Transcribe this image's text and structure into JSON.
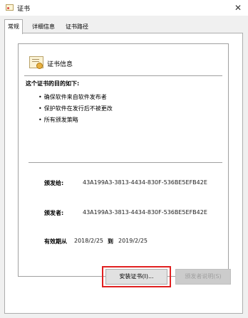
{
  "window": {
    "title": "证书",
    "close_glyph": "✕",
    "icon": "certificate-icon"
  },
  "tabs": [
    {
      "label": "常规",
      "active": true
    },
    {
      "label": "详细信息",
      "active": false
    },
    {
      "label": "证书路径",
      "active": false
    }
  ],
  "cert_info": {
    "title": "证书信息",
    "purpose_heading": "这个证书的目的如下:",
    "purposes": [
      "确保软件来自软件发布者",
      "保护软件在发行后不被更改",
      "所有颁发策略"
    ],
    "issued_to_label": "颁发给:",
    "issued_to_value": "43A199A3-3813-4434-830F-536BE5EFB42E",
    "issued_by_label": "颁发者:",
    "issued_by_value": "43A199A3-3813-4434-830F-536BE5EFB42E",
    "validity_label": "有效期从",
    "valid_from": "2018/2/25",
    "to_label": "到",
    "valid_to": "2019/2/25"
  },
  "buttons": {
    "install_label": "安装证书(I)...",
    "issuer_statement_label": "颁发者说明(S)"
  },
  "colors": {
    "highlight": "#e02020"
  }
}
